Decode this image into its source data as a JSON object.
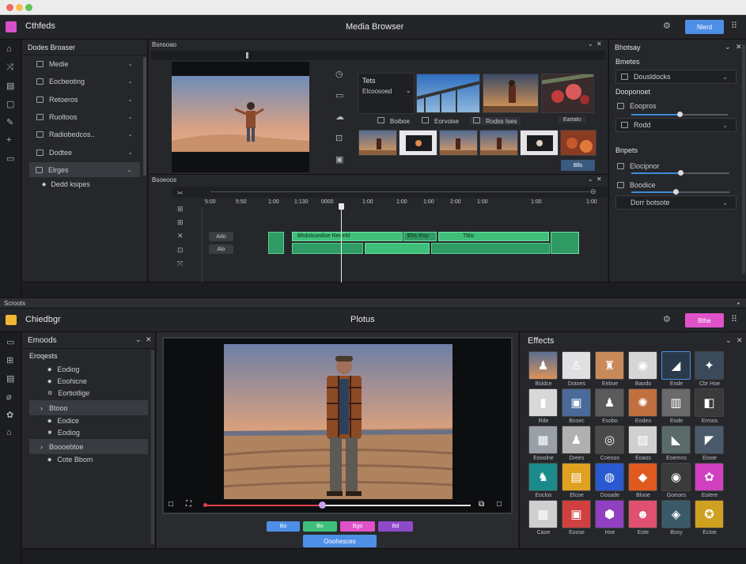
{
  "window": {
    "title_left": "Cthfeds",
    "title_center": "Media Browser",
    "top_button": "Nlerd",
    "bottom_title_left": "Chiedbgr",
    "bottom_title_center": "Plotus",
    "bottom_button": "Bthe"
  },
  "media_browser": {
    "header": "Dodes Broaser",
    "items": [
      "Medie",
      "Eocbeoting",
      "Retoeros",
      "Ruoltoos",
      "Radiobedcos..",
      "Dodtee",
      "Elrges"
    ],
    "sub_item": "Dedd ksipes"
  },
  "viewer": {
    "label": "Bsnsoao"
  },
  "browser_grid": {
    "panel_title": "Tets",
    "dropdown": "Elcoosoed",
    "tabs": [
      "Boiboe",
      "Eorvoise",
      "Rodss Ises"
    ],
    "grid_label": "Eartalo",
    "button": "Blls"
  },
  "timeline": {
    "label": "Bsoeoos",
    "ticks": [
      "5:00",
      "5:50",
      "1:00",
      "1:130",
      "0000",
      "1:00",
      "1:00",
      "1:00",
      "2:00",
      "1:00",
      "1:00",
      "1:00"
    ],
    "track_labels": [
      "Ado",
      "Alo"
    ],
    "clip_labels": [
      "Bhdolssedise Reoefd",
      "Ehs Ihsy",
      "Tltlis"
    ]
  },
  "inspector": {
    "header": "Bhotsay",
    "section1": "Bmetes",
    "dropdown1": "Dousldocks",
    "section2": "Dooponoet",
    "row1": "Eoopros",
    "row2": "Rodd",
    "section3": "Bnpets",
    "row3": "Elocipnor",
    "row4": "Boodice",
    "dropdown2": "Dorr botsote"
  },
  "divider": {
    "label": "Scroots"
  },
  "effects_list": {
    "header": "Emoods",
    "root": "Eroqests",
    "items": [
      "Eodiog",
      "Eoohicne",
      "Eortiotlige"
    ],
    "group1": "Btooo",
    "group1_items": [
      "Eodice",
      "Eodiog"
    ],
    "group2": "Boooebtoe",
    "group2_items": [
      "Cote Bbom"
    ]
  },
  "player": {
    "progress": 0.44,
    "buttons": [
      "Bo",
      "Bo",
      "Bgo",
      "Bd"
    ],
    "wide_button": "Ooohesces"
  },
  "effects_grid": {
    "header": "Effects",
    "labels": [
      "Bsldce",
      "Dotoes",
      "Eeboe",
      "Baodo",
      "Ende",
      "Cbr Hoe",
      "Rde",
      "Bosec",
      "Esobo",
      "Eodeo",
      "Eode",
      "Erroos",
      "Eooolne",
      "Drees",
      "Coeoos",
      "Eoaos",
      "Eoemns",
      "Eiooe",
      "Eoclos",
      "Elcoe",
      "Dosade",
      "Blooe",
      "Goeoes",
      "Eolere",
      "Caoe",
      "Eoose",
      "Hoe",
      "Eote",
      "Bosy",
      "Ecloe"
    ]
  },
  "colors": {
    "accent_blue": "#4d8fe6",
    "accent_pink": "#e052c8",
    "clip_green": "#3fc07a",
    "playhead_red": "#e0404a"
  }
}
